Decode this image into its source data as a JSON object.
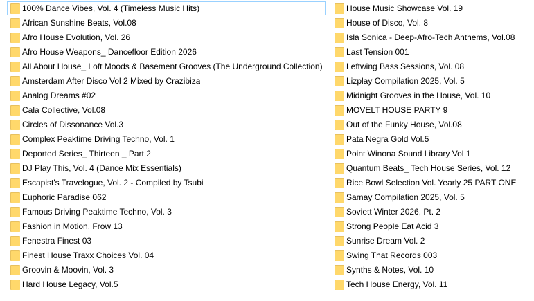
{
  "left_column": [
    {
      "label": "100% Dance Vibes, Vol. 4 (Timeless Music Hits)",
      "selected": true
    },
    {
      "label": "African Sunshine Beats, Vol.08"
    },
    {
      "label": "Afro House Evolution, Vol. 26"
    },
    {
      "label": "Afro House Weapons_ Dancefloor Edition 2026"
    },
    {
      "label": "All About House_ Loft Moods & Basement Grooves (The Underground Collection)"
    },
    {
      "label": "Amsterdam After Disco Vol 2 Mixed by Crazibiza"
    },
    {
      "label": "Analog Dreams #02"
    },
    {
      "label": "Cala Collective, Vol.08"
    },
    {
      "label": "Circles of Dissonance Vol.3"
    },
    {
      "label": "Complex Peaktime Driving Techno, Vol. 1"
    },
    {
      "label": "Deported Series_ Thirteen _ Part 2"
    },
    {
      "label": "DJ Play This, Vol. 4 (Dance Mix Essentials)"
    },
    {
      "label": "Escapist's Travelogue, Vol. 2 - Compiled by Tsubi"
    },
    {
      "label": "Euphoric Paradise 062"
    },
    {
      "label": "Famous Driving Peaktime Techno, Vol. 3"
    },
    {
      "label": "Fashion in Motion, Frow 13"
    },
    {
      "label": "Fenestra Finest 03"
    },
    {
      "label": "Finest House Traxx Choices Vol. 04"
    },
    {
      "label": "Groovin & Moovin, Vol. 3"
    },
    {
      "label": "Hard House Legacy, Vol.5"
    }
  ],
  "right_column": [
    {
      "label": "House Music Showcase Vol. 19"
    },
    {
      "label": "House of Disco, Vol. 8"
    },
    {
      "label": "Isla Sonica - Deep-Afro-Tech Anthems, Vol.08"
    },
    {
      "label": "Last Tension 001"
    },
    {
      "label": "Leftwing Bass Sessions, Vol. 08"
    },
    {
      "label": "Lizplay Compilation 2025, Vol. 5"
    },
    {
      "label": "Midnight Grooves in the House, Vol. 10"
    },
    {
      "label": "MOVELT HOUSE PARTY 9"
    },
    {
      "label": "Out of the Funky House, Vol.08"
    },
    {
      "label": "Pata Negra Gold Vol.5"
    },
    {
      "label": "Point Winona Sound Library Vol 1"
    },
    {
      "label": "Quantum Beats_ Tech House Series, Vol. 12"
    },
    {
      "label": "Rice Bowl Selection Vol. Yearly 25 PART ONE"
    },
    {
      "label": "Samay Compilation 2025, Vol. 5"
    },
    {
      "label": "Soviett Winter 2026, Pt. 2"
    },
    {
      "label": "Strong People Eat Acid 3"
    },
    {
      "label": "Sunrise Dream Vol. 2"
    },
    {
      "label": "Swing That Records 003"
    },
    {
      "label": "Synths & Notes, Vol. 10"
    },
    {
      "label": "Tech House Energy, Vol. 11"
    }
  ],
  "colors": {
    "folder_front": "#ffd86b",
    "folder_back": "#e8c15f",
    "selection_border": "#99d1ff"
  },
  "icons": {
    "item_icon": "folder-icon"
  }
}
